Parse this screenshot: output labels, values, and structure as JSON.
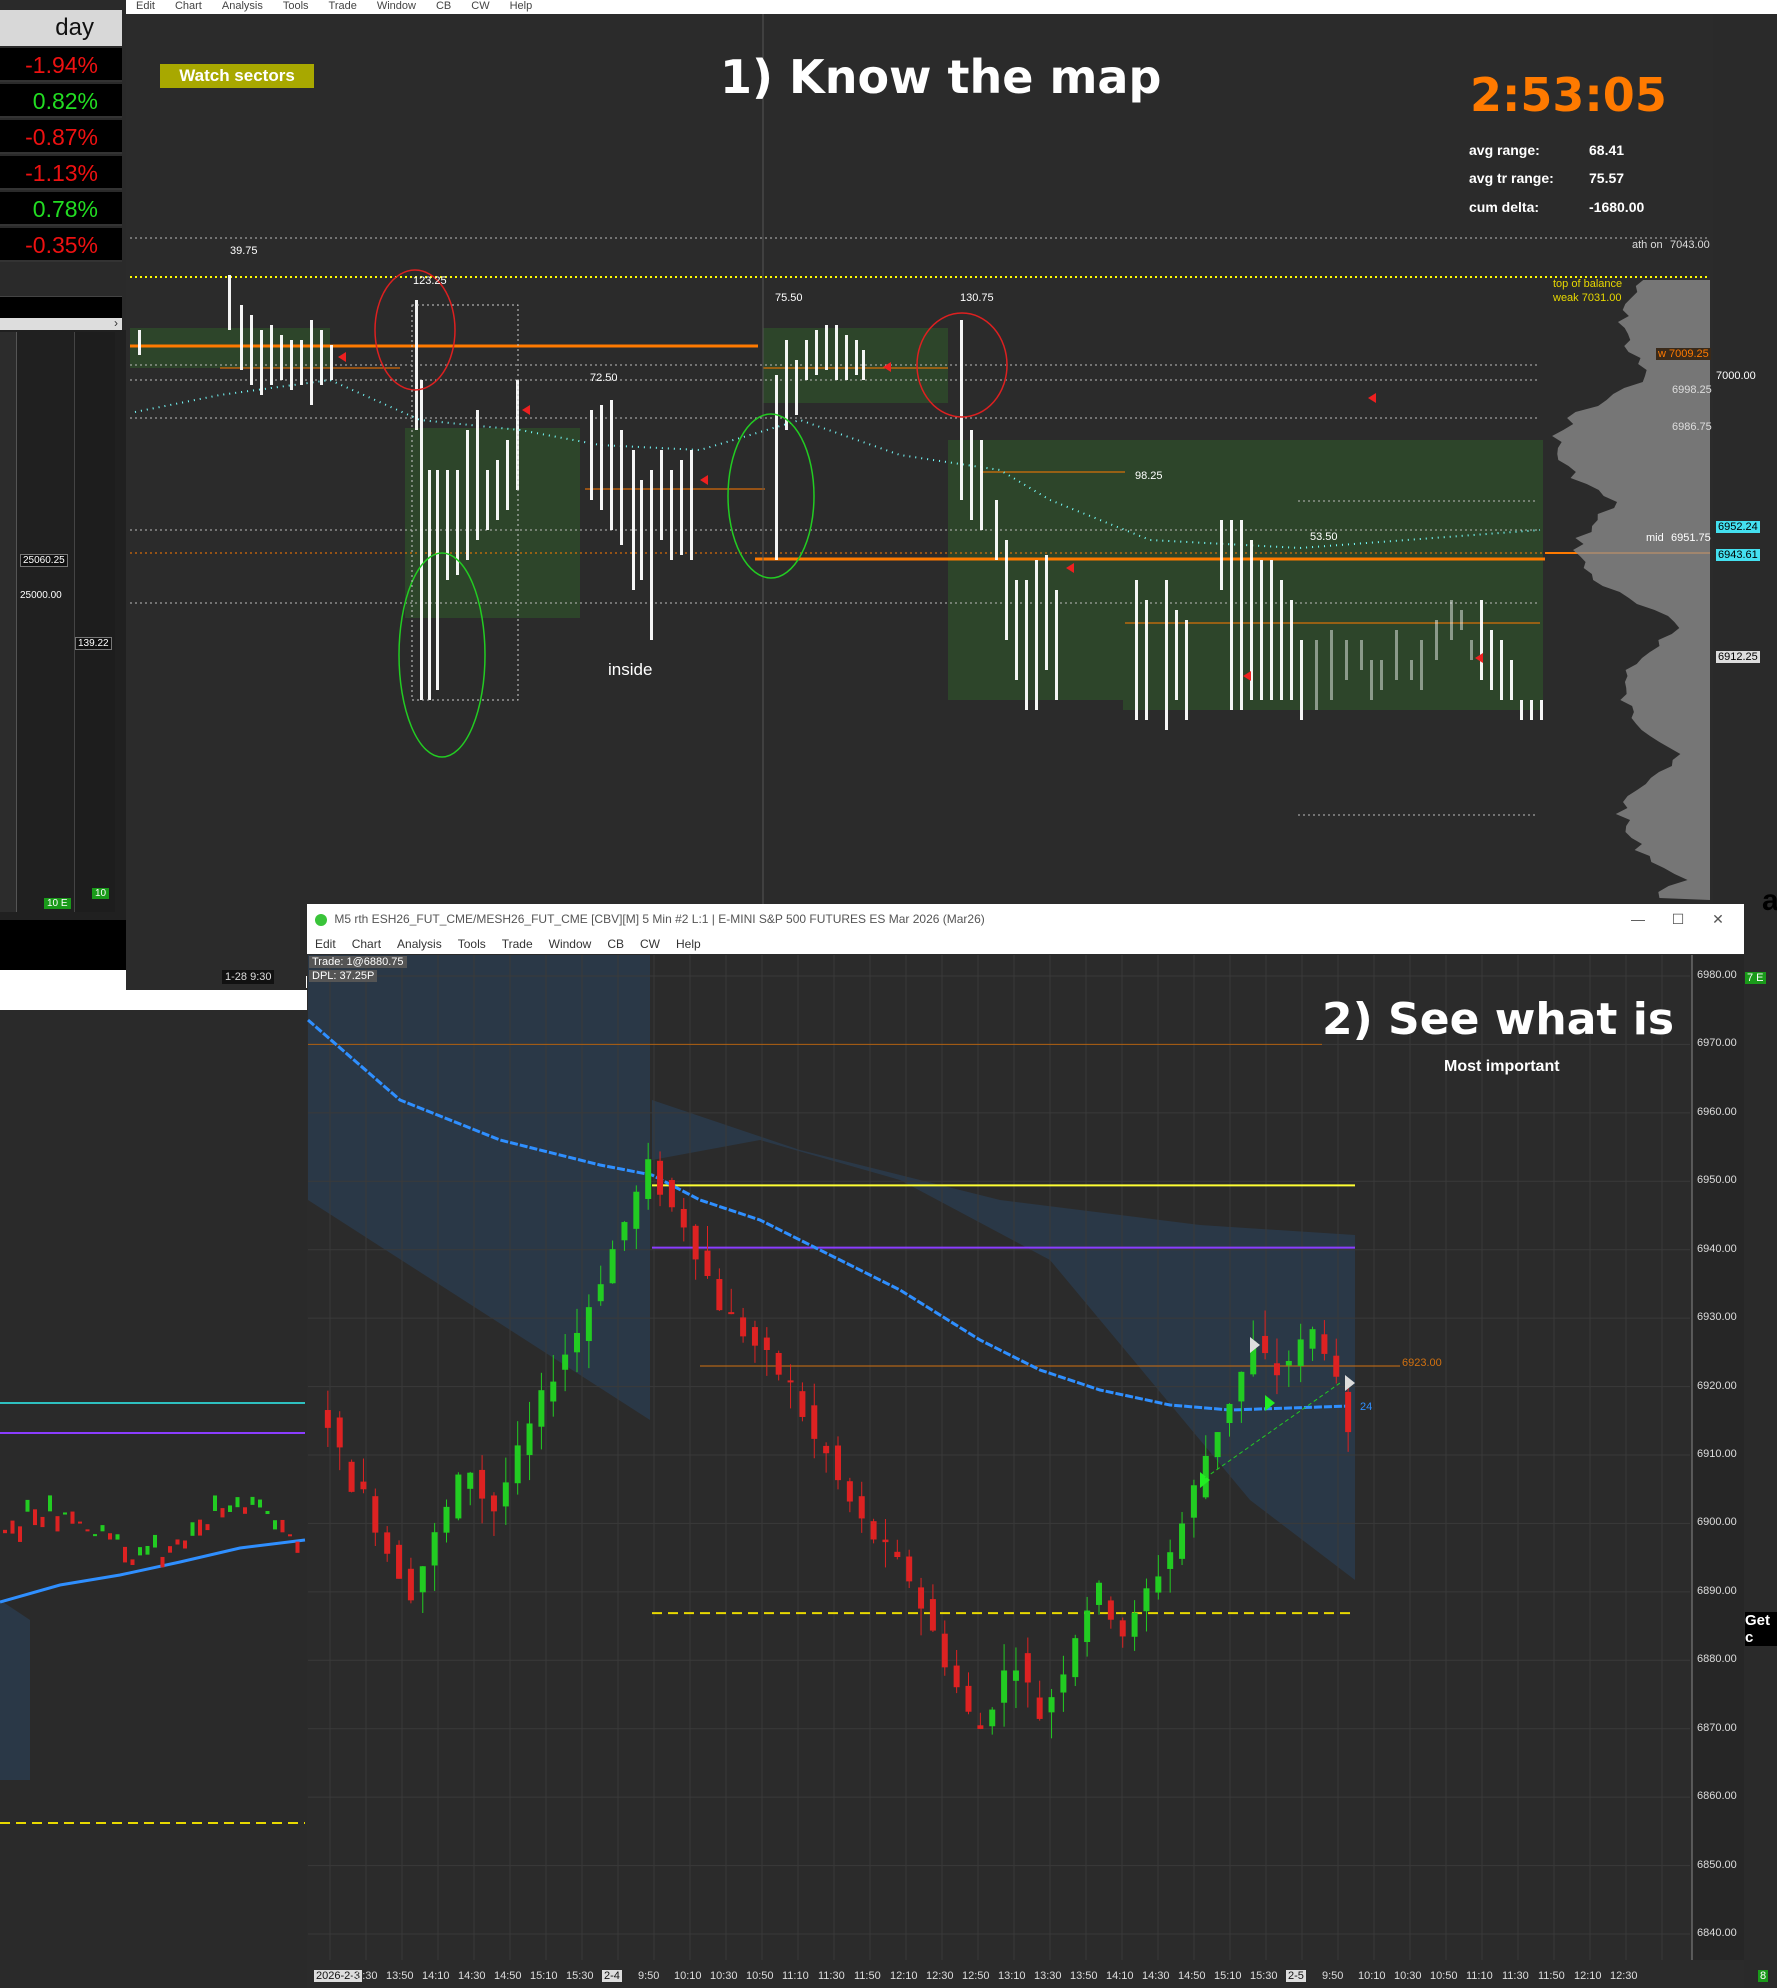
{
  "day_panel": {
    "header": "day",
    "rows": [
      {
        "value": "-1.94%",
        "sign": "neg"
      },
      {
        "value": "0.82%",
        "sign": "pos"
      },
      {
        "value": "-0.87%",
        "sign": "neg"
      },
      {
        "value": "-1.13%",
        "sign": "neg"
      },
      {
        "value": "0.78%",
        "sign": "pos"
      },
      {
        "value": "-0.35%",
        "sign": "neg"
      }
    ]
  },
  "left_chart": {
    "price_a": "25060.25",
    "price_b": "25000.00",
    "price_c": "139.22",
    "badge_a": "10 E",
    "badge_b": "10"
  },
  "window1": {
    "menu": [
      "Edit",
      "Chart",
      "Analysis",
      "Tools",
      "Trade",
      "Window",
      "CB",
      "CW",
      "Help"
    ],
    "watch_button": "Watch sectors",
    "heading": "1)  Know the map",
    "timer": "2:53:05",
    "stats": [
      {
        "label": "avg range:",
        "value": "68.41"
      },
      {
        "label": "avg tr range:",
        "value": "75.57"
      },
      {
        "label": "cum delta:",
        "value": "-1680.00"
      }
    ],
    "ath_label": "ath on",
    "ath_value": "7043.00",
    "top_balance_label": "top of balance",
    "top_balance_value": "weak  7031.00",
    "w_label": "w",
    "w_value": "7009.25",
    "p7000": "7000.00",
    "p6998": "6998.25",
    "p6986": "6986.75",
    "p6952": "6952.24",
    "mid_label": "mid",
    "mid_value": "6951.75",
    "p6943": "6943.61",
    "p6912": "6912.25",
    "bar_labels": [
      "39.75",
      "123.25",
      "72.50",
      "75.50",
      "130.75",
      "98.25",
      "53.50"
    ],
    "inside_label": "inside",
    "date_label": "1-28  9:30"
  },
  "window2": {
    "title": "M5 rth ESH26_FUT_CME/MESH26_FUT_CME [CBV][M]  5 Min  #2 L:1 | E-MINI S&P 500 FUTURES ES Mar 2026 (Mar26)",
    "menu": [
      "Edit",
      "Chart",
      "Analysis",
      "Tools",
      "Trade",
      "Window",
      "CB",
      "CW",
      "Help"
    ],
    "trade_info": "Trade: 1@6880.75",
    "dpl_info": "DPL: 37.25P",
    "heading": "2)  See what is",
    "subheading": "Most important",
    "price_6923_label": "6923.00",
    "label_24": "24",
    "y_ticks": [
      "6980.00",
      "6970.00",
      "6960.00",
      "6950.00",
      "6940.00",
      "6930.00",
      "6920.00",
      "6910.00",
      "6900.00",
      "6890.00",
      "6880.00",
      "6870.00",
      "6860.00",
      "6850.00",
      "6840.00"
    ],
    "x_ticks": [
      "2026-2-3",
      "13:30",
      "13:50",
      "14:10",
      "14:30",
      "14:50",
      "15:10",
      "15:30",
      "2-4",
      "9:50",
      "10:10",
      "10:30",
      "10:50",
      "11:10",
      "11:30",
      "11:50",
      "12:10",
      "12:30",
      "12:50",
      "13:10",
      "13:30",
      "13:50",
      "14:10",
      "14:30",
      "14:50",
      "15:10",
      "15:30",
      "2-5",
      "9:50",
      "10:10",
      "10:30",
      "10:50",
      "11:10",
      "11:30",
      "11:50",
      "12:10",
      "12:30"
    ],
    "right_badge_a": "7 E",
    "right_badge_b": "8",
    "right_text_a": "Get c",
    "right_text_b": "ai"
  },
  "colors": {
    "orange": "#ff7a00",
    "yellow": "#ffff00",
    "green_box": "#2e4a2a",
    "bull": "#22cc22",
    "bear": "#dd2222",
    "vwap": "#2f8fff"
  }
}
